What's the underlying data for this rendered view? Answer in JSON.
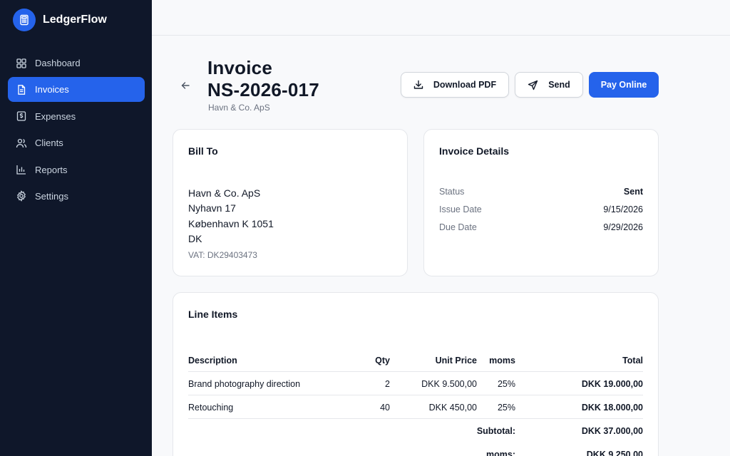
{
  "app": {
    "name": "LedgerFlow"
  },
  "sidebar": {
    "items": [
      {
        "label": "Dashboard",
        "icon": "dashboard-icon"
      },
      {
        "label": "Invoices",
        "icon": "file-icon",
        "active": true
      },
      {
        "label": "Expenses",
        "icon": "dollar-receipt-icon"
      },
      {
        "label": "Clients",
        "icon": "users-icon"
      },
      {
        "label": "Reports",
        "icon": "bar-chart-icon"
      },
      {
        "label": "Settings",
        "icon": "gear-icon"
      }
    ]
  },
  "header": {
    "title_line1": "Invoice",
    "title_line2": "NS-2026-017",
    "subtitle": "Havn & Co. ApS",
    "download_label": "Download PDF",
    "send_label": "Send",
    "pay_label": "Pay Online"
  },
  "bill_to": {
    "title": "Bill To",
    "name": "Havn & Co. ApS",
    "street": "Nyhavn 17",
    "city": "København K 1051",
    "country": "DK",
    "vat": "VAT: DK29403473"
  },
  "details": {
    "title": "Invoice Details",
    "status_label": "Status",
    "status_value": "Sent",
    "issue_label": "Issue Date",
    "issue_value": "9/15/2026",
    "due_label": "Due Date",
    "due_value": "9/29/2026"
  },
  "line_items": {
    "title": "Line Items",
    "headers": {
      "description": "Description",
      "qty": "Qty",
      "unit_price": "Unit Price",
      "moms": "moms",
      "total": "Total"
    },
    "rows": [
      {
        "description": "Brand photography direction",
        "qty": "2",
        "unit_price": "DKK 9.500,00",
        "moms": "25%",
        "total": "DKK 19.000,00"
      },
      {
        "description": "Retouching",
        "qty": "40",
        "unit_price": "DKK 450,00",
        "moms": "25%",
        "total": "DKK 18.000,00"
      }
    ],
    "subtotal_label": "Subtotal:",
    "subtotal_value": "DKK 37.000,00",
    "moms_label": "moms:",
    "moms_value": "DKK 9.250,00"
  },
  "colors": {
    "sidebar_bg": "#0f172a",
    "accent": "#2563eb",
    "page_bg": "#f8f9fb"
  }
}
